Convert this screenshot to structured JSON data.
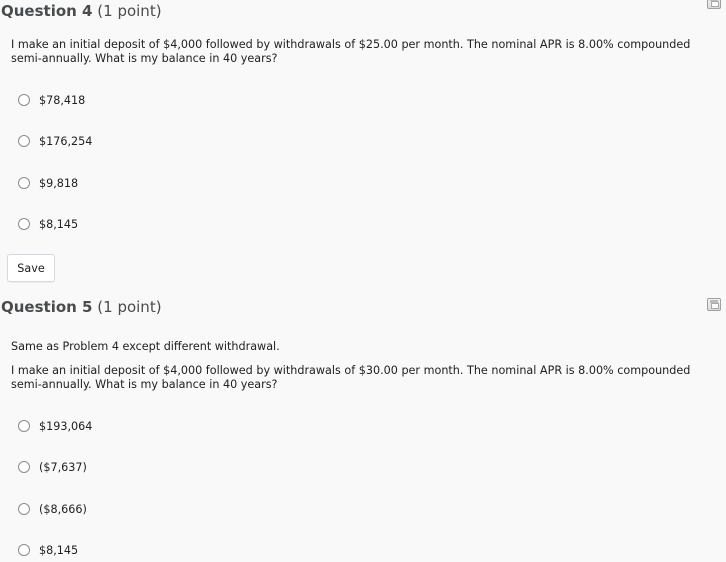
{
  "questions": [
    {
      "title": "Question 4",
      "points": "(1 point)",
      "prompt": "I make an initial deposit of $4,000 followed by withdrawals of $25.00 per month. The nominal APR is 8.00% compounded semi-annually. What is my balance in 40 years?",
      "options": [
        "$78,418",
        "$176,254",
        "$9,818",
        "$8,145"
      ],
      "save_label": "Save"
    },
    {
      "title": "Question 5",
      "points": "(1 point)",
      "intro": "Same as Problem 4 except different withdrawal.",
      "prompt": "I make an initial deposit of $4,000 followed by withdrawals of $30.00 per month. The nominal APR is 8.00% compounded semi-annually. What is my balance in 40 years?",
      "options": [
        "$193,064",
        "($7,637)",
        "($8,666)",
        "$8,145"
      ]
    }
  ]
}
